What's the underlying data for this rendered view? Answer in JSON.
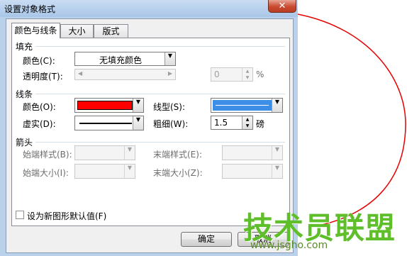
{
  "window": {
    "title": "设置对象格式",
    "close_glyph": "✕"
  },
  "tabs": [
    {
      "label": "颜色与线条",
      "active": true
    },
    {
      "label": "大小",
      "active": false
    },
    {
      "label": "版式",
      "active": false
    }
  ],
  "fill": {
    "section_label": "填充",
    "color_label": "颜色(C):",
    "color_value": "无填充颜色",
    "transparency_label": "透明度(T):",
    "transparency_value": "0",
    "transparency_unit": "%"
  },
  "line": {
    "section_label": "线条",
    "color_label": "颜色(O):",
    "color_swatch": "#ff0000",
    "style_label": "线型(S):",
    "style_swatch": "#3d8ee6",
    "dash_label": "虚实(D):",
    "weight_label": "粗细(W):",
    "weight_value": "1.5",
    "weight_unit": "磅"
  },
  "arrows": {
    "section_label": "箭头",
    "begin_style_label": "始端样式(B):",
    "end_style_label": "末端样式(E):",
    "begin_size_label": "始端大小(I):",
    "end_size_label": "末端大小(Z):"
  },
  "default_checkbox": {
    "label": "设为新图形默认值(F)",
    "checked": false
  },
  "buttons": {
    "ok": "确定",
    "cancel": "取消"
  },
  "watermark": {
    "title": "技术员联盟",
    "url": "www.jsgho.com"
  },
  "colors": {
    "annotation": "#e60000",
    "title_bar": "#b9d1ea"
  }
}
